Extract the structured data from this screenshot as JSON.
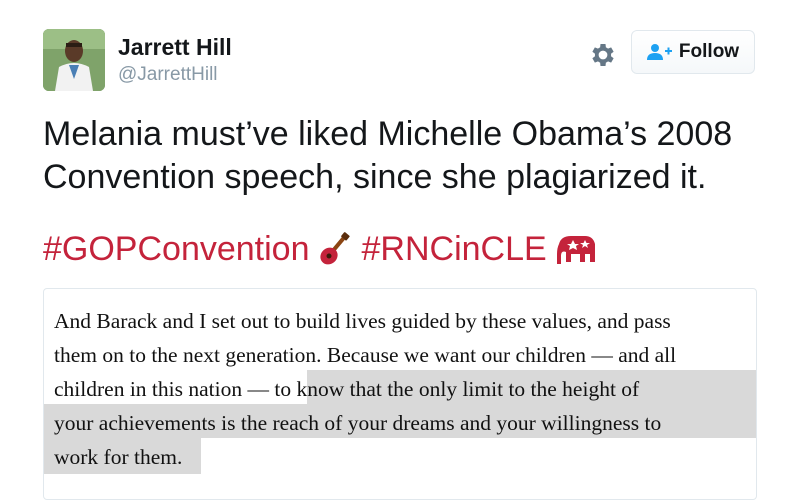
{
  "user": {
    "name": "Jarrett Hill",
    "handle": "@JarrettHill"
  },
  "actions": {
    "settings_icon": "gear-icon",
    "follow_label": "Follow",
    "follow_icon": "follow-person-plus-icon"
  },
  "tweet": {
    "text_line_1": "Melania must’ve liked Michelle Obama’s 2008",
    "text_line_2": "Convention speech, since she plagiarized it.",
    "hashtag_1": "#GOPConvention",
    "hashtag_1_emoji": "guitar-emoji",
    "hashtag_2": "#RNCinCLE",
    "hashtag_2_emoji": "elephant-emoji",
    "hashtag_color": "#c4233b"
  },
  "quote": {
    "lines": [
      "And Barack and I set out to build lives guided by these values, and pass",
      "them on to the next generation. Because we want our children — and all",
      "children in this nation — ",
      "to know that the only limit to the height of",
      "your achievements is the reach of your dreams and your willingness to",
      "work for them."
    ],
    "highlight_color": "#d9d9d9"
  }
}
